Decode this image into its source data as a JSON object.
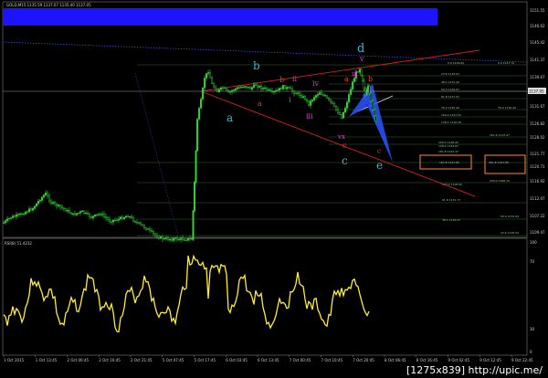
{
  "window": {
    "symbol_info": "GOLD,M15  1135.59  1137.07  1135.40  1137.05",
    "current_price": "1137.05"
  },
  "price_axis": [
    "1151.55",
    "1146.62",
    "1141.37",
    "1136.52",
    "1131.67",
    "1126.82",
    "1121.77",
    "1116.92",
    "1112.07",
    "1107.22",
    "1102.37",
    "1109.47",
    "1145.42",
    "1139.67",
    "1128.02",
    "1120.71"
  ],
  "fib_levels_right": [
    "0.0 1136.62",
    "23.6 1133.97",
    "38.2 1131.42",
    "50.0 1129.67",
    "61.8 1127.97",
    "76.4 1125.42",
    "100.0 1121.52",
    "138.2 1116.39",
    "161.8 1112.47",
    "200.0 1106.12"
  ],
  "fib_levels_left": [
    "0.0 1137.72",
    "23.6 1135.52",
    "38.2 1134.07",
    "50.0 1132.92",
    "61.8 1131.77",
    "76.4 1130.42",
    "100.0 1128.22",
    "138.2 1124.67",
    "161.8 1122.47",
    "200.0 1118.92"
  ],
  "box_labels": [
    "161.8 1121.82",
    "261.8 1121.82"
  ],
  "wave_labels": {
    "b_big": "b",
    "a_big": "a",
    "c_big": "c",
    "d_big": "d",
    "e_big": "e",
    "a_small": "a",
    "b_small": "b",
    "c_small": "c",
    "a2": "a",
    "b2": "b",
    "c2": "c",
    "i": "i",
    "ii": "ii",
    "iii": "iii",
    "iv": "iv",
    "v": "v",
    "vx": "vx",
    "iii_small": "iii",
    "v_top": "v"
  },
  "rsi": {
    "label": "RSI(8) 51.4232",
    "levels": [
      "100",
      "70",
      "30",
      "0"
    ]
  },
  "time_axis": [
    "1 Oct 2015",
    "1 Oct 13:45",
    "2 Oct 00:45",
    "2 Oct 10:45",
    "2 Oct 21:45",
    "5 Oct 07:45",
    "5 Oct 17:45",
    "6 Oct 03:45",
    "6 Oct 13:45",
    "7 Oct 00:45",
    "7 Oct 10:45",
    "7 Oct 20:45",
    "8 Oct 06:45",
    "8 Oct 16:45",
    "9 Oct 02:45",
    "9 Oct 12:45",
    "9 Oct 22:45"
  ],
  "watermark": "[1275x839] http://upic.me/",
  "colors": {
    "background": "#000000",
    "candles": "#33dd33",
    "rsi_line": "#ffee33",
    "header_bar": "#1c14ff",
    "trend_red": "#d02020",
    "fib_green": "#2d6b2d",
    "highlight_box": "#ff8a3a",
    "wave_cyan": "#35b6d8",
    "wave_magenta": "#e33ad2",
    "wave_red": "#e04030",
    "projection_blue": "#2a55ff"
  }
}
